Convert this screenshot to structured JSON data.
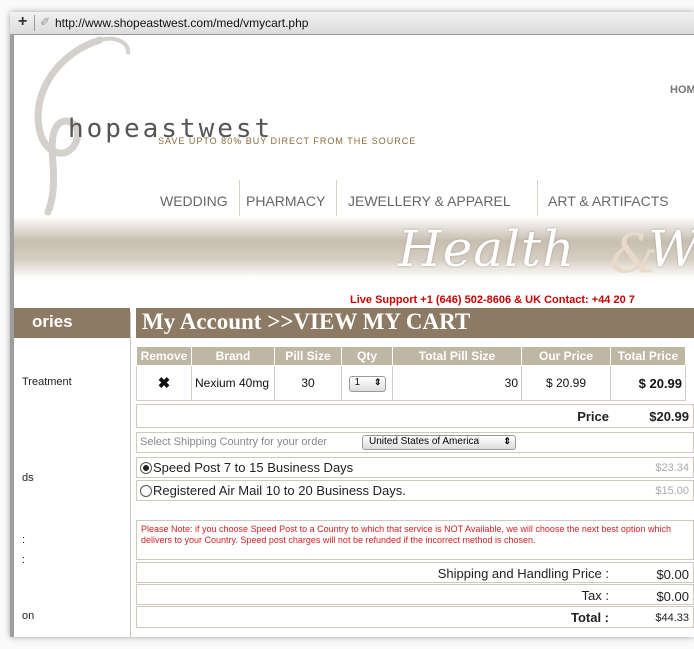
{
  "browser": {
    "url": "http://www.shopeastwest.com/med/vmycart.php",
    "plus_glyph": "+"
  },
  "site": {
    "logo_text": "hopeastwest",
    "tagline": "SAVE UPTO 80% BUY DIRECT FROM THE SOURCE",
    "home_label": "HOME",
    "nav": [
      "WEDDING",
      "PHARMACY",
      "JEWELLERY & APPAREL",
      "ART & ARTIFACTS"
    ],
    "banner_text": "Health",
    "banner_amp": "&",
    "banner_tail": "W",
    "support_text": "Live Support +1 (646) 502-8606 & UK Contact: +44 20 7"
  },
  "sidebar": {
    "heading": "ories",
    "items": [
      "Treatment",
      "ds",
      ":",
      ":",
      "on"
    ]
  },
  "cart": {
    "title": "My Account >>VIEW MY CART",
    "columns": [
      "Remove",
      "Brand",
      "Pill Size",
      "Qty",
      "Total Pill Size",
      "Our Price",
      "Total Price"
    ],
    "rows": [
      {
        "remove_glyph": "✖",
        "brand": "Nexium 40mg",
        "pill_size": "30",
        "qty": "1",
        "total_pill_size": "30",
        "our_price": "$ 20.99",
        "total_price": "$ 20.99"
      }
    ],
    "price_label": "Price",
    "price_value": "$20.99",
    "shipping_country_label": "Select Shipping Country for your order",
    "shipping_country": "United States of America",
    "shipping_options": [
      {
        "label": "Speed Post 7 to 15 Business Days",
        "price": "$23.34",
        "selected": true
      },
      {
        "label": "Registered Air Mail 10 to 20 Business Days.",
        "price": "$15.00",
        "selected": false
      }
    ],
    "note": "Please Note: if you choose Speed Post to a Country to which that service is NOT Available, we will choose the next best option which delivers to your Country. Speed post charges will not be refunded if the incorrect method is chosen.",
    "summary": {
      "shipping_label": "Shipping and Handling Price :",
      "shipping_value": "$0.00",
      "tax_label": "Tax :",
      "tax_value": "$0.00",
      "total_label": "Total :",
      "total_value": "$44.33"
    }
  },
  "colors": {
    "accent": "#8c7a64",
    "table_header": "#bfb6a3",
    "alert": "#cc0000"
  }
}
